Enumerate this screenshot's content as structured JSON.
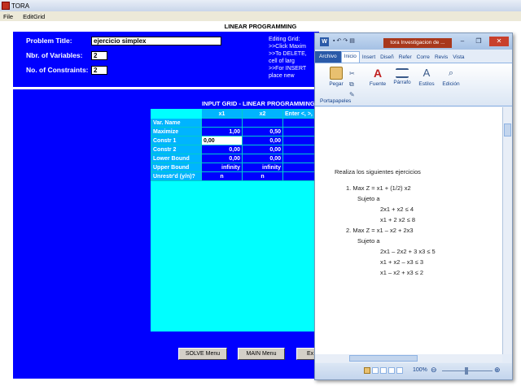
{
  "tora": {
    "app_title": "TORA",
    "menu": [
      "File",
      "EditGrid"
    ],
    "lp_heading": "LINEAR PROGRAMMING",
    "problem_title_label": "Problem Title:",
    "problem_title_value": "ejercicio simplex",
    "nbr_vars_label": "Nbr. of Variables:",
    "nbr_vars_value": "2",
    "nbr_cons_label": "No. of Constraints:",
    "nbr_cons_value": "2",
    "editing_help": [
      "Editing Grid:",
      ">>Click Maxim",
      ">>To DELETE,",
      "   cell of larg",
      ">>For INSERT",
      "   place new"
    ],
    "grid_title": "INPUT GRID - LINEAR PROGRAMMING",
    "grid": {
      "col_headers": [
        "x1",
        "x2",
        "Enter <, >, o"
      ],
      "rows": [
        {
          "label": "Var. Name",
          "cells": [
            "",
            ""
          ]
        },
        {
          "label": "Maximize",
          "cells": [
            "1,00",
            "0,50"
          ]
        },
        {
          "label": "Constr 1",
          "cells": [
            "0,00",
            "0,00"
          ]
        },
        {
          "label": "Constr 2",
          "cells": [
            "0,00",
            "0,00"
          ]
        },
        {
          "label": "Lower Bound",
          "cells": [
            "0,00",
            "0,00"
          ]
        },
        {
          "label": "Upper Bound",
          "cells": [
            "infinity",
            "infinity"
          ]
        },
        {
          "label": "Unrestr'd (y/n)?",
          "cells": [
            "n",
            "n"
          ]
        }
      ]
    },
    "buttons": {
      "solve": "SOLVE Menu",
      "main": "MAIN Menu",
      "exit": "Ex"
    }
  },
  "word": {
    "doc_title": "tora Investigacion de ...",
    "tabs": [
      "Archivo",
      "Inicio",
      "Insert",
      "Diseñ",
      "Refer",
      "Corre",
      "Revis",
      "Vista"
    ],
    "ribbon": {
      "paste": "Pegar",
      "font": "Fuente",
      "paragraph": "Párrafo",
      "styles": "Estilos",
      "editing": "Edición",
      "clipboard": "Portapapeles"
    },
    "document_lines": [
      "Realiza los siguientes ejercicios",
      "1.     Max Z = x1 + (1/2) x2",
      "Sujeto a",
      "2x1 + x2 ≤ 4",
      "x1 + 2 x2 ≤ 8",
      "2.     Max Z = x1 – x2 + 2x3",
      "Sujeto a",
      "2x1 – 2x2 + 3 x3 ≤ 5",
      "x1 + x2 – x3 ≤ 3",
      "x1 – x2 + x3 ≤ 2"
    ],
    "zoom": "100%"
  },
  "colors": {
    "tora_panel": "#0000ff",
    "grid_bg": "#00ffff",
    "word_accent": "#2a5aa8"
  }
}
